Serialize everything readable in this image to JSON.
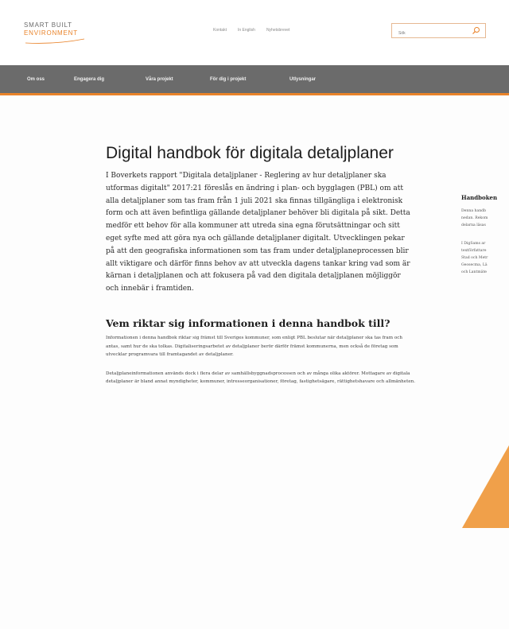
{
  "header": {
    "logo_line1": "SMART BUILT",
    "logo_line2": "ENVIRONMENT",
    "top_links": [
      "Kontakt",
      "In English",
      "Nyhetsbrevet"
    ],
    "search": {
      "placeholder": "Sök"
    }
  },
  "nav": {
    "items": [
      "Om oss",
      "Engagera dig",
      "Våra projekt",
      "För dig i projekt",
      "Utlysningar"
    ],
    "active": "Våra projekt"
  },
  "breadcrumb": [],
  "main": {
    "title": "Digital handbok för digitala detaljplaner",
    "lead": "I Boverkets rapport \"Digitala detaljplaner - Reglering av hur detaljplaner ska utformas digitalt\" 2017:21 föreslås en ändring i plan- och bygglagen (PBL) om att alla detaljplaner som tas fram från 1 juli 2021 ska finnas tillgängliga i elektronisk form och att även befintliga gällande detaljplaner behöver bli digitala på sikt. Detta medför ett behov för alla kommuner att utreda sina egna förutsättningar och sitt eget syfte med att göra nya och gällande detaljplaner digitalt. Utvecklingen pekar på att den geografiska informationen som tas fram under detaljplaneprocessen blir allt viktigare och därför finns behov av att utveckla dagens tankar kring vad som är kärnan i detaljplanen och att fokusera på vad den digitala detaljplanen möjliggör och innebär i framtiden.",
    "h2": "Vem riktar sig informationen i denna handbok till?",
    "para1": "Informationen i denna handbok riktar sig främst till Sveriges kommuner, som enligt PBL beslutar när detaljplaner ska tas fram och antas, samt hur de ska tolkas. Digitaliseringsarbetet av detaljplaner berör därför främst kommunerna, men också de företag som utvecklar programvara till framtagandet av detaljplaner.",
    "para2": "Detaljplaneinformationen används dock i flera delar av samhällsbyggnadsprocessen och av många olika aktörer. Mottagare av digitala detaljplaner är bland annat myndigheter, kommuner, intresseorganisationer, företag, fastighetsägare, rättighetshavare och allmänheten."
  },
  "sidebar": {
    "title": "Handboken",
    "text1": "Denna handb\nnedan. Rekom\ndelarna läsas",
    "text2": "I DigSams ar\ntextförfattare\nStad och Metr\nGeosecma, Lä\noch Lantmäte"
  },
  "colors": {
    "accent": "#e9832a",
    "nav_bg": "#6b6b6b",
    "text": "#1d1d1d"
  }
}
